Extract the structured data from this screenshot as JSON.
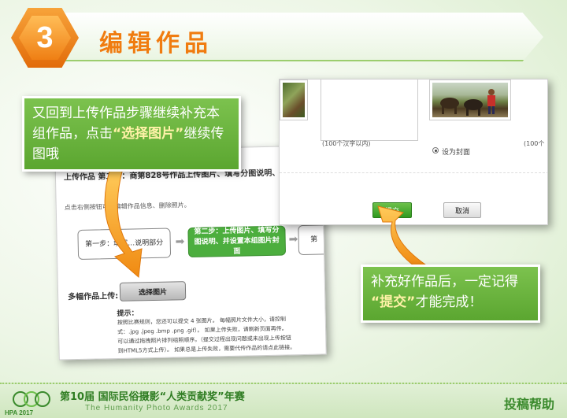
{
  "header": {
    "step_number": "3",
    "title": "编辑作品"
  },
  "left_card": {
    "heading": "上传作品 第二步：商第828号作品上传图片、填写分图说明、并",
    "hint": "点击右侧按钮可…编辑作品信息、删除照片。",
    "flow_step1": "第一步：填写…说明部分",
    "flow_step2": "第二步：上传图片、填写分图说明、并设置本组图片封面",
    "flow_step3": "第",
    "multi_label": "多幅作品上传:",
    "select_button": "选择图片",
    "tips_title": "提示：",
    "tips_lines": [
      "按照比赛规则，您还可以提交 4 张图片。 每幅照片文件大小，请控制",
      "式：.jpg .jpeg .bmp .png .gif）。 如果上传失败，请刷新页面再传。",
      "可以通过拖拽照片排列组照顺序。（提交过程出现问题或未出现上传按钮",
      "到HTML5方式上传）。 如果总是上传失败，需要代传作品的请点此链接。"
    ]
  },
  "right_card": {
    "char_limit_note": "(100个汉字以内)",
    "char_limit_note_2": "(100个",
    "cover_label": "设为封面",
    "submit_button": "提交",
    "cancel_button": "取消"
  },
  "callouts": {
    "c1_part1": "又回到上传作品步骤继续补充本组作品，点击",
    "c1_highlight": "“选择图片”",
    "c1_part2": "继续传图哦",
    "c2_part1": "补充好作品后，一定记得",
    "c2_highlight": "“提交”",
    "c2_part2": "才能完成！"
  },
  "footer": {
    "logo_text": "HPA 2017",
    "title": "第10届 国际民俗摄影“人类贡献奖”年赛",
    "subtitle": "The Humanity Photo Awards 2017",
    "help": "投稿帮助"
  },
  "colors": {
    "accent_orange": "#f07c10",
    "accent_green": "#5ba630",
    "highlight": "#fff2a8"
  }
}
